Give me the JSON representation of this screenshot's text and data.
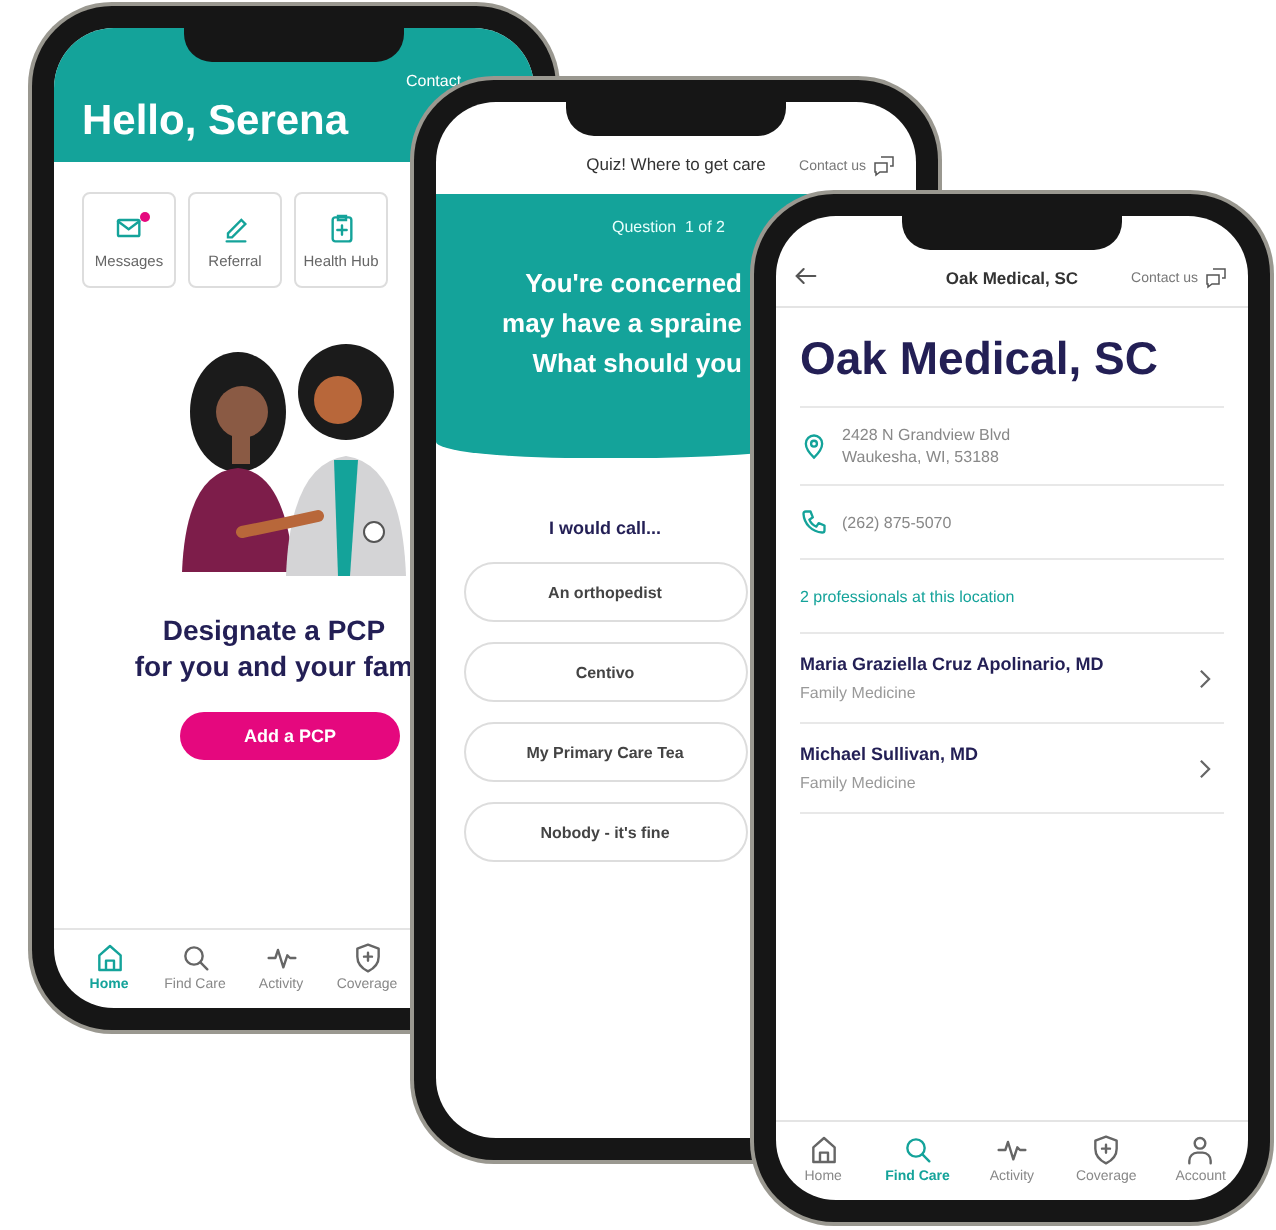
{
  "home_screen": {
    "contact": "Contact",
    "greeting": "Hello, Serena",
    "tiles": [
      {
        "label": "Messages",
        "badge": true
      },
      {
        "label": "Referral",
        "badge": false
      },
      {
        "label": "Health Hub",
        "badge": false
      }
    ],
    "headline": [
      "Designate a PCP",
      "for you and your fam"
    ],
    "button": "Add a PCP",
    "nav": [
      {
        "label": "Home",
        "selected": true
      },
      {
        "label": "Find Care",
        "selected": false
      },
      {
        "label": "Activity",
        "selected": false
      },
      {
        "label": "Coverage",
        "selected": false
      }
    ]
  },
  "quiz_screen": {
    "title": "Quiz! Where to get care",
    "contact": "Contact us",
    "progress": "Question  1 of 2",
    "question": [
      "You're concerned",
      "may have a spraine",
      "What should you"
    ],
    "prompt": "I would call...",
    "options": [
      "An orthopedist",
      "Centivo",
      "My Primary Care Tea",
      "Nobody - it's fine"
    ]
  },
  "clinic_screen": {
    "title": "Oak Medical, SC",
    "contact": "Contact us",
    "name": "Oak Medical, SC",
    "address": [
      "2428 N Grandview Blvd",
      "Waukesha, WI, 53188"
    ],
    "phone": "(262) 875-5070",
    "count_link": "2 professionals at this location",
    "providers": [
      {
        "name": "Maria Graziella Cruz Apolinario, MD",
        "specialty": "Family Medicine"
      },
      {
        "name": "Michael Sullivan, MD",
        "specialty": "Family Medicine"
      }
    ],
    "nav": [
      {
        "label": "Home",
        "selected": false
      },
      {
        "label": "Find Care",
        "selected": true
      },
      {
        "label": "Activity",
        "selected": false
      },
      {
        "label": "Coverage",
        "selected": false
      },
      {
        "label": "Account",
        "selected": false
      }
    ]
  }
}
